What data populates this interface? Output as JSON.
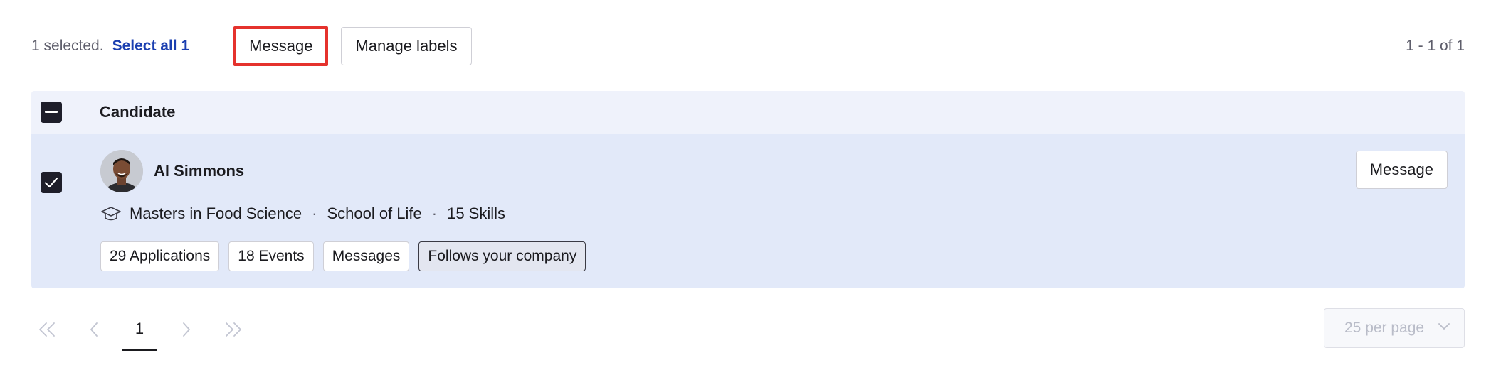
{
  "toolbar": {
    "selected_text": "1 selected.",
    "select_all_label": "Select all 1",
    "message_label": "Message",
    "manage_labels_label": "Manage labels",
    "range_text": "1 - 1 of 1"
  },
  "table": {
    "header": {
      "column_label": "Candidate",
      "checkbox_state": "indeterminate"
    },
    "rows": [
      {
        "checked": true,
        "name": "Al Simmons",
        "degree": "Masters in Food Science",
        "school": "School of Life",
        "skills": "15 Skills",
        "message_label": "Message",
        "chips": [
          "29 Applications",
          "18 Events",
          "Messages",
          "Follows your company"
        ]
      }
    ]
  },
  "pagination": {
    "current_page": "1",
    "per_page": "25 per page"
  },
  "colors": {
    "accent_link": "#1b3fb0",
    "highlight_border": "#e5322d",
    "row_selected_bg": "#e2e9f9",
    "header_bg": "#eff2fb"
  },
  "icons": [
    "checkbox-indeterminate-icon",
    "checkbox-checked-icon",
    "graduation-cap-icon",
    "double-chevron-left-icon",
    "chevron-left-icon",
    "chevron-right-icon",
    "double-chevron-right-icon",
    "chevron-down-icon"
  ]
}
